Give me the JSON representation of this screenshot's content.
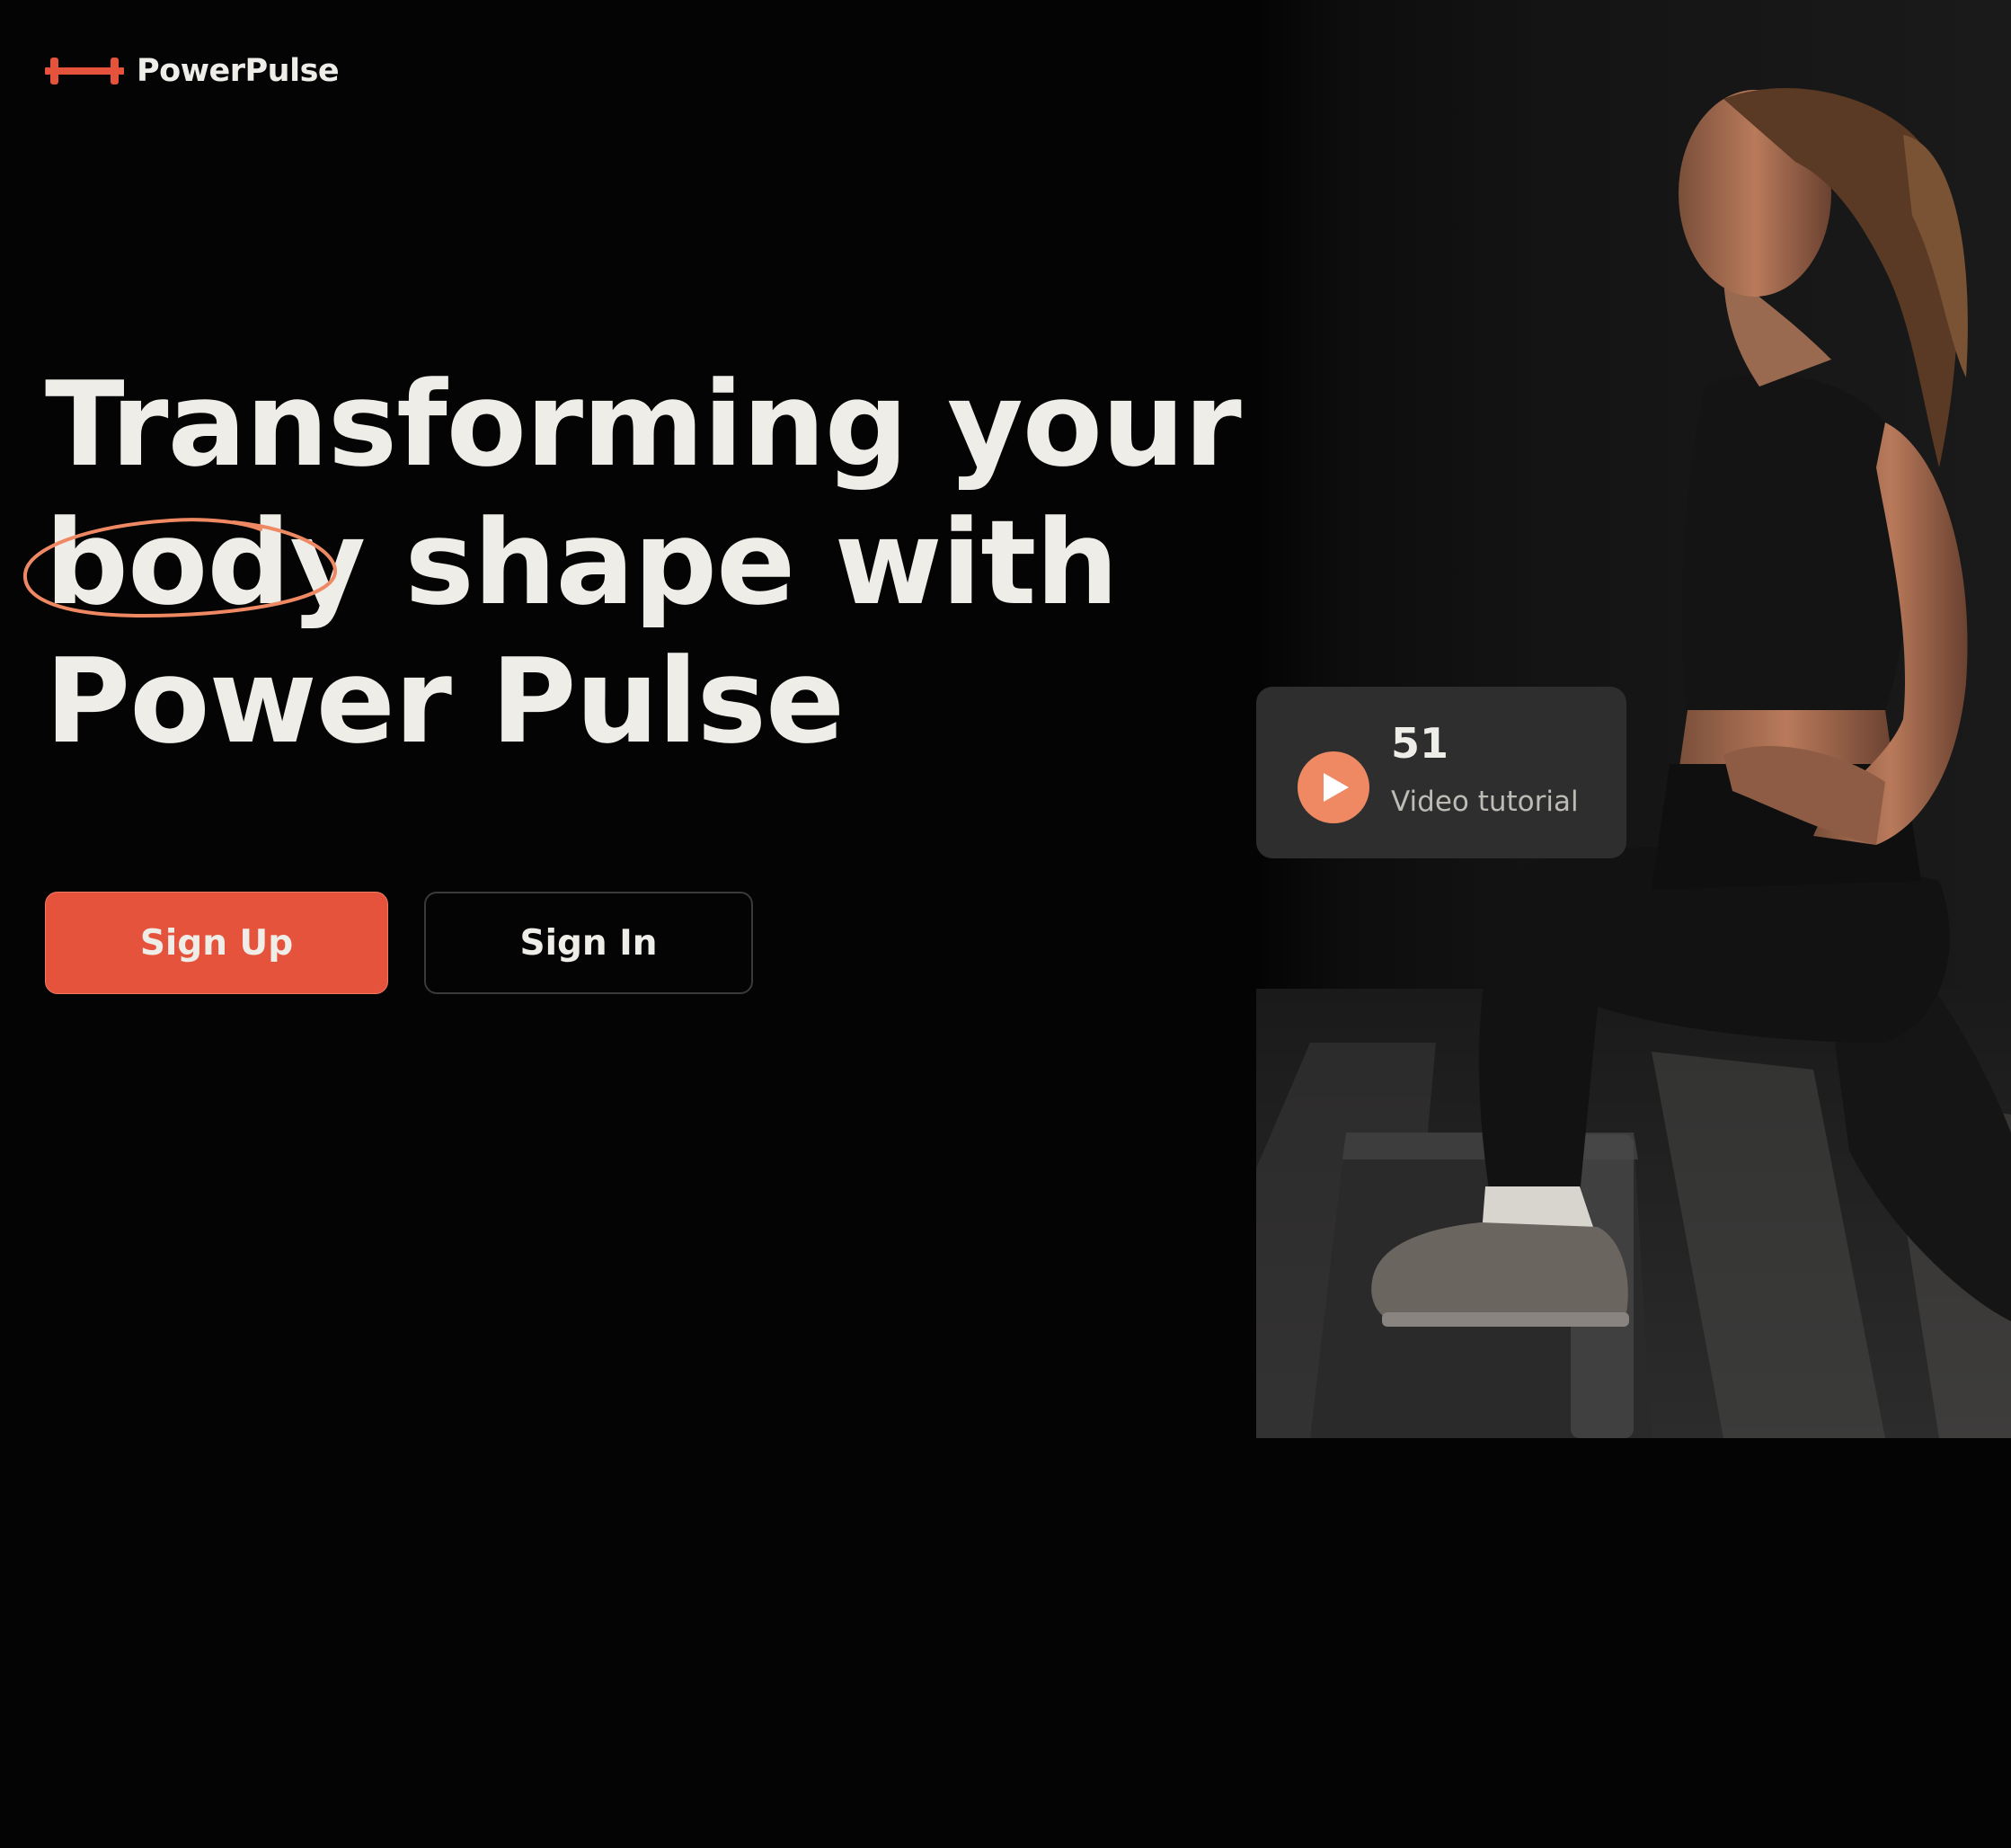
{
  "brand": {
    "name": "PowerPulse",
    "logo_icon": "dumbbell-icon",
    "accent_color": "#e6533c"
  },
  "hero": {
    "headline_line1": "Transforming your",
    "headline_highlight": "body",
    "headline_line2_rest": " shape with",
    "headline_line3": "Power Pulse",
    "highlight_stroke_color": "#ef8964"
  },
  "actions": {
    "sign_up_label": "Sign Up",
    "sign_in_label": "Sign In"
  },
  "video_card": {
    "count": "51",
    "label": "Video tutorial",
    "icon": "play-icon"
  },
  "image": {
    "subject": "woman-lunging-on-step-platform-photo"
  }
}
